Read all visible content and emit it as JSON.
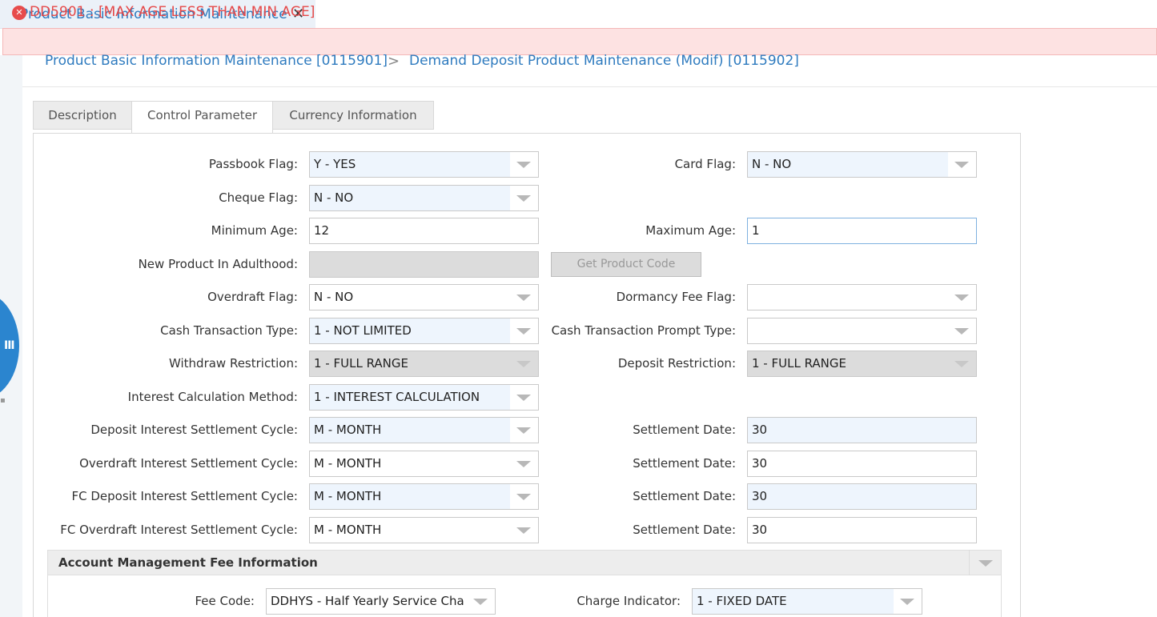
{
  "window_tab": {
    "title": "Product Basic Information Maintenance",
    "close": "✕"
  },
  "error": {
    "icon": "error-circle-icon",
    "message": "DD5901 : [MAX AGE LESS THAN MIN AGE]"
  },
  "breadcrumb": {
    "items": [
      "Product Basic Information Maintenance [0115901]",
      "Demand Deposit Product Maintenance (Modif) [0115902]"
    ],
    "separator": ">"
  },
  "side_handle": {
    "icon": "menu-bars-icon",
    "glyph": "III"
  },
  "tabs": [
    {
      "label": "Description",
      "active": false
    },
    {
      "label": "Control Parameter",
      "active": true
    },
    {
      "label": "Currency Information",
      "active": false
    }
  ],
  "form": {
    "passbook_flag": {
      "label": "Passbook Flag:",
      "value": "Y - YES"
    },
    "card_flag": {
      "label": "Card Flag:",
      "value": "N - NO"
    },
    "cheque_flag": {
      "label": "Cheque Flag:",
      "value": "N - NO"
    },
    "minimum_age": {
      "label": "Minimum Age:",
      "value": "12"
    },
    "maximum_age": {
      "label": "Maximum Age:",
      "value": "1"
    },
    "new_product_adulthood": {
      "label": "New Product In Adulthood:",
      "value": ""
    },
    "get_product_code": "Get Product Code",
    "overdraft_flag": {
      "label": "Overdraft Flag:",
      "value": "N - NO"
    },
    "dormancy_fee_flag": {
      "label": "Dormancy Fee Flag:",
      "value": ""
    },
    "cash_transaction_type": {
      "label": "Cash Transaction Type:",
      "value": "1 - NOT LIMITED"
    },
    "cash_transaction_prompt_type": {
      "label": "Cash Transaction Prompt Type:",
      "value": ""
    },
    "withdraw_restriction": {
      "label": "Withdraw Restriction:",
      "value": "1 - FULL RANGE"
    },
    "deposit_restriction": {
      "label": "Deposit Restriction:",
      "value": "1 - FULL RANGE"
    },
    "interest_calc_method": {
      "label": "Interest Calculation Method:",
      "value": "1 - INTEREST CALCULATION"
    },
    "deposit_int_cycle": {
      "label": "Deposit Interest Settlement Cycle:",
      "value": "M - MONTH"
    },
    "deposit_settle_date": {
      "label": "Settlement Date:",
      "value": "30"
    },
    "overdraft_int_cycle": {
      "label": "Overdraft Interest Settlement Cycle:",
      "value": "M - MONTH"
    },
    "overdraft_settle_date": {
      "label": "Settlement Date:",
      "value": "30"
    },
    "fc_deposit_int_cycle": {
      "label": "FC Deposit Interest Settlement Cycle:",
      "value": "M - MONTH"
    },
    "fc_deposit_settle_date": {
      "label": "Settlement Date:",
      "value": "30"
    },
    "fc_overdraft_int_cycle": {
      "label": "FC Overdraft Interest Settlement Cycle:",
      "value": "M - MONTH"
    },
    "fc_overdraft_settle_date": {
      "label": "Settlement Date:",
      "value": "30"
    }
  },
  "fee_section": {
    "title": "Account Management Fee Information",
    "fee_code": {
      "label": "Fee Code:",
      "value": "DDHYS - Half Yearly Service Cha"
    },
    "charge_indicator": {
      "label": "Charge Indicator:",
      "value": "1 - FIXED DATE"
    }
  },
  "colors": {
    "accent": "#2f7bbf",
    "error_bg": "#fde2e2",
    "error_text": "#e54848",
    "field_fill": "#eef5fd",
    "disabled": "#dcdcdc"
  }
}
